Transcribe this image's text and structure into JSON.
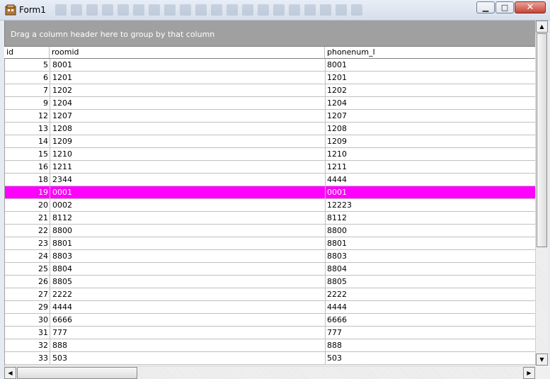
{
  "window": {
    "title": "Form1",
    "minimize_glyph": "▁",
    "maximize_glyph": "□",
    "close_glyph": "✕"
  },
  "group_panel": {
    "text": "Drag a column header here to group by that column"
  },
  "columns": [
    "id",
    "roomid",
    "phonenum_l"
  ],
  "selected_row_index": 10,
  "selection_color": "#ff00ff",
  "rows": [
    [
      "5",
      "8001",
      "8001"
    ],
    [
      "6",
      "1201",
      "1201"
    ],
    [
      "7",
      "1202",
      "1202"
    ],
    [
      "9",
      "1204",
      "1204"
    ],
    [
      "12",
      "1207",
      "1207"
    ],
    [
      "13",
      "1208",
      "1208"
    ],
    [
      "14",
      "1209",
      "1209"
    ],
    [
      "15",
      "1210",
      "1210"
    ],
    [
      "16",
      "1211",
      "1211"
    ],
    [
      "18",
      "2344",
      "4444"
    ],
    [
      "19",
      "0001",
      "0001"
    ],
    [
      "20",
      "0002",
      "12223"
    ],
    [
      "21",
      "8112",
      "8112"
    ],
    [
      "22",
      "8800",
      "8800"
    ],
    [
      "23",
      "8801",
      "8801"
    ],
    [
      "24",
      "8803",
      "8803"
    ],
    [
      "25",
      "8804",
      "8804"
    ],
    [
      "26",
      "8805",
      "8805"
    ],
    [
      "27",
      "2222",
      "2222"
    ],
    [
      "29",
      "4444",
      "4444"
    ],
    [
      "30",
      "6666",
      "6666"
    ],
    [
      "31",
      "777",
      "777"
    ],
    [
      "32",
      "888",
      "888"
    ],
    [
      "33",
      "503",
      "503"
    ]
  ],
  "scrollbar": {
    "up": "▲",
    "down": "▼",
    "left": "◀",
    "right": "▶"
  }
}
